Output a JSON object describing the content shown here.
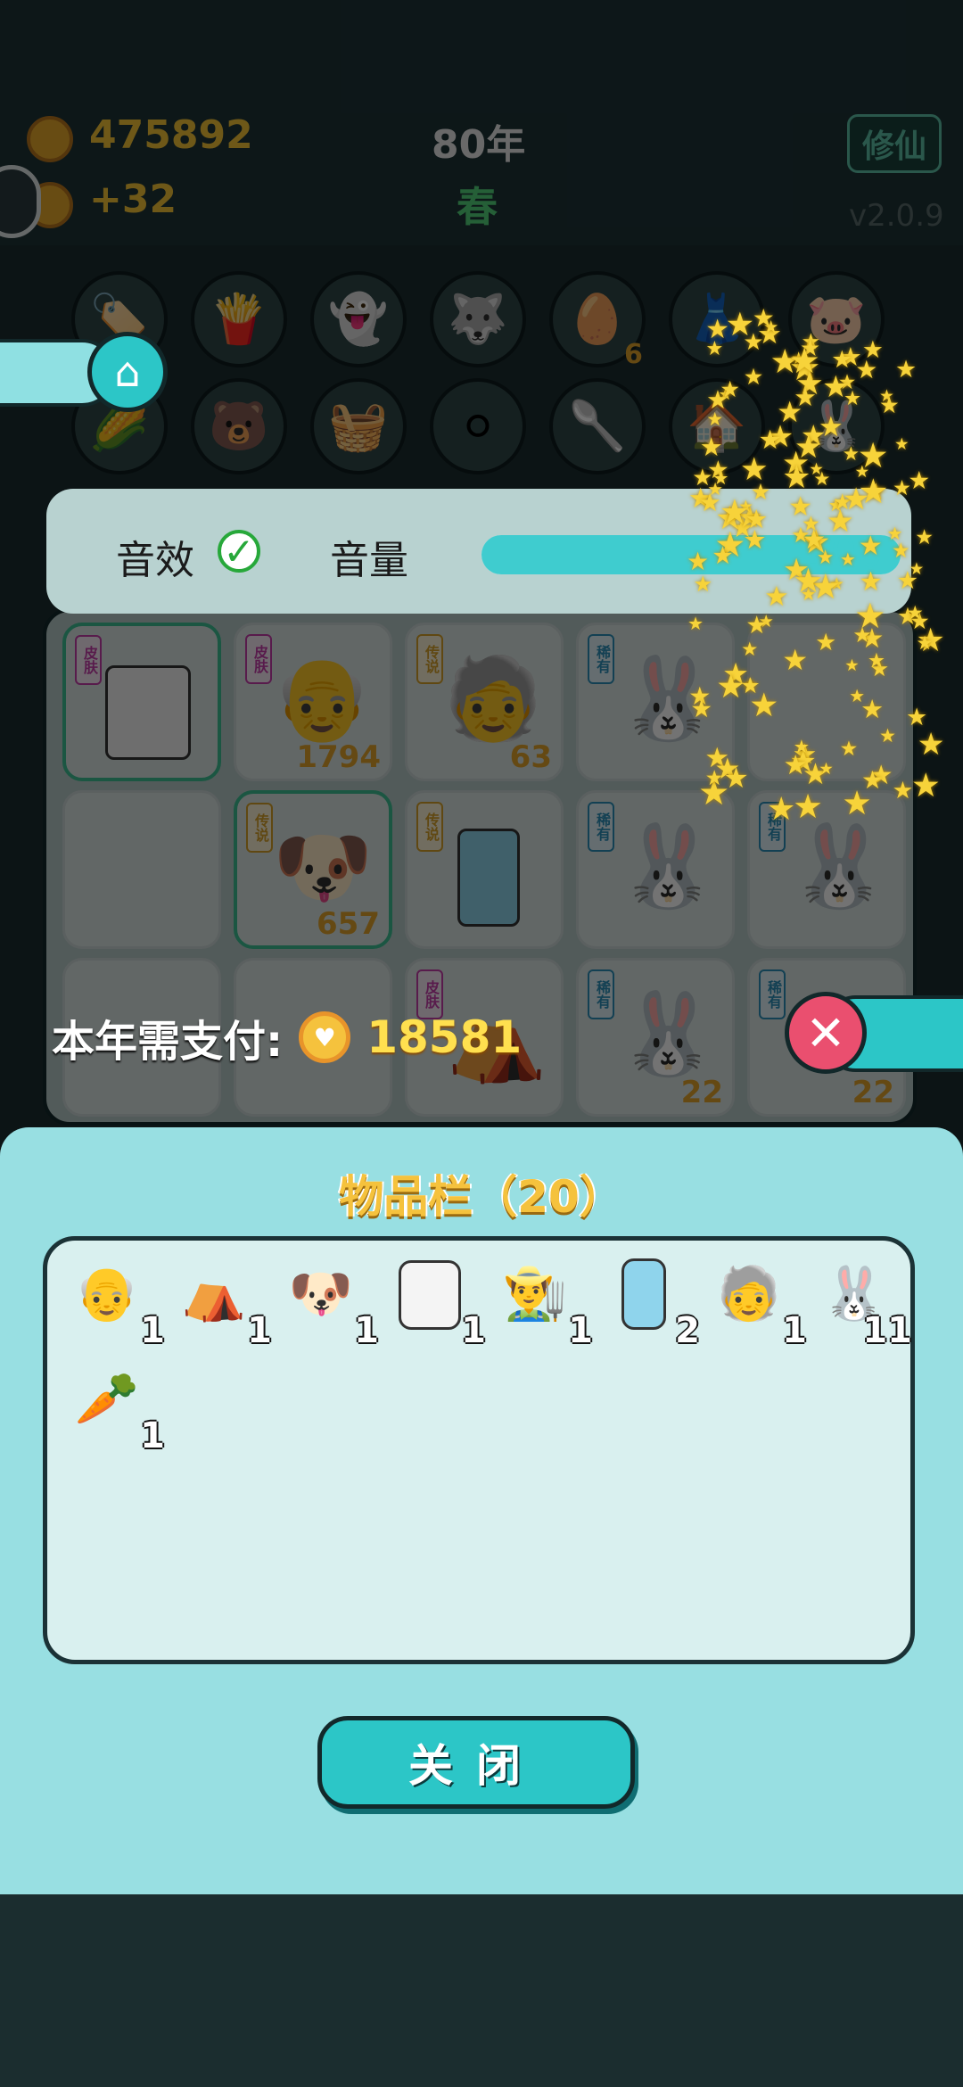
{
  "top": {
    "coins": "475892",
    "income": "+32",
    "year": "80年",
    "season": "春",
    "mode_button": "修仙",
    "version": "v2.0.9"
  },
  "colors": {
    "accent_teal": "#2cc6c7",
    "gold": "#f5c23d",
    "panel_bg": "#98dfe2"
  },
  "settings": {
    "sound_label": "音效",
    "sound_checked": true,
    "volume_label": "音量",
    "volume_value": "100",
    "volume_fraction": 1.0
  },
  "board": {
    "cards": [
      {
        "tag": "皮肤",
        "count": ""
      },
      {
        "tag": "皮肤",
        "count": "1794"
      },
      {
        "tag": "传说",
        "count": "63"
      },
      {
        "tag": "稀有",
        "count": ""
      },
      {
        "tag": "",
        "count": ""
      },
      {
        "tag": "",
        "count": ""
      },
      {
        "tag": "传说",
        "count": "657"
      },
      {
        "tag": "传说",
        "count": ""
      },
      {
        "tag": "稀有",
        "count": ""
      },
      {
        "tag": "稀有",
        "count": ""
      },
      {
        "tag": "",
        "count": ""
      },
      {
        "tag": "",
        "count": ""
      },
      {
        "tag": "皮肤",
        "count": ""
      },
      {
        "tag": "稀有",
        "count": "22"
      },
      {
        "tag": "稀有",
        "count": "22"
      }
    ],
    "row_counts": [
      "6"
    ]
  },
  "payment": {
    "label": "本年需支付:",
    "amount": "18581"
  },
  "inventory": {
    "title": "物品栏（20）",
    "items": [
      {
        "icon": "old-man-with-cap-icon",
        "count": "1"
      },
      {
        "icon": "rabbit-tent-icon",
        "count": "1"
      },
      {
        "icon": "crowned-dog-icon",
        "count": "1"
      },
      {
        "icon": "copy-paste-icon",
        "count": "1"
      },
      {
        "icon": "farmer-face-icon",
        "count": "1"
      },
      {
        "icon": "refrigerator-icon",
        "count": "2"
      },
      {
        "icon": "bald-glasses-man-icon",
        "count": "1"
      },
      {
        "icon": "red-vest-rabbit-icon",
        "count": "11"
      },
      {
        "icon": "carrot-icon",
        "count": "1"
      }
    ],
    "close_label": "关闭"
  }
}
